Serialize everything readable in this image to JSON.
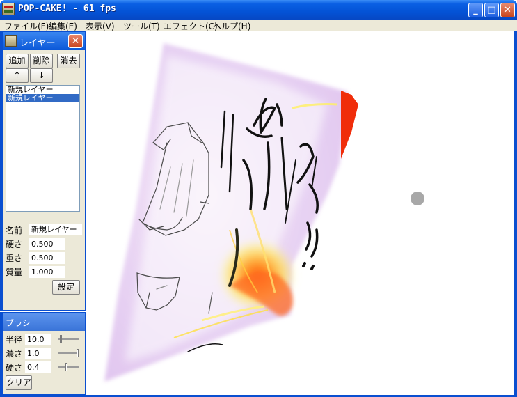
{
  "window": {
    "title": "POP-CAKE! - 61 fps",
    "minimize": "_",
    "maximize": "□",
    "close": "✕"
  },
  "menu": [
    "ファイル(F)",
    "編集(E)",
    "表示(V)",
    "ツール(T)",
    "エフェクト(C)",
    "ヘルプ(H)"
  ],
  "layer_panel": {
    "title": "レイヤー",
    "close": "✕",
    "buttons": {
      "add": "追加",
      "delete": "削除",
      "erase": "消去",
      "up": "↑",
      "down": "↓"
    },
    "layers": [
      {
        "name": "新規レイヤー",
        "selected": false
      },
      {
        "name": "新規レイヤー",
        "selected": true
      }
    ],
    "props": {
      "name_label": "名前",
      "name_value": "新規レイヤー",
      "hardness_label": "硬さ",
      "hardness_value": "0.500",
      "weight_label": "重さ",
      "weight_value": "0.500",
      "mass_label": "質量",
      "mass_value": "1.000",
      "apply": "設定"
    }
  },
  "brush_panel": {
    "title": "ブラシ",
    "radius_label": "半径",
    "radius_value": "10.0",
    "density_label": "濃さ",
    "density_value": "1.0",
    "hardness_label": "硬さ",
    "hardness_value": "0.4",
    "clear": "クリア"
  },
  "colors": {
    "titlebar": "#0453d6",
    "face": "#ece9d8",
    "selection": "#316ac5",
    "cursor": "#a8a8a8"
  }
}
